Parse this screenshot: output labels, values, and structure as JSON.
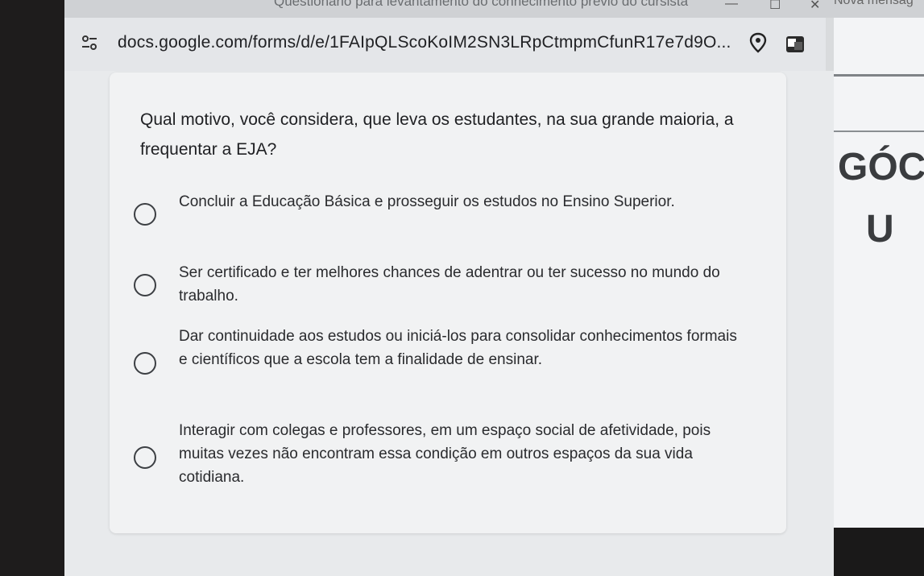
{
  "browser": {
    "window_title": "Questionário para levantamento do conhecimento prévio do cursista",
    "window_controls": {
      "minimize": "—",
      "maximize": "☐",
      "close": "✕"
    },
    "side_tab_text": "Nova mensag",
    "url": "docs.google.com/forms/d/e/1FAIpQLScoKoIM2SN3LRpCtmpmCfunR17e7d9O...",
    "icons": [
      "site-settings-icon",
      "location-icon",
      "translate-icon"
    ]
  },
  "form": {
    "question": "Qual motivo, você considera, que leva os estudantes, na sua grande maioria, a frequentar a EJA?",
    "options": [
      {
        "label": "Concluir a Educação Básica e prosseguir os estudos no Ensino Superior."
      },
      {
        "label": "Ser certificado e ter melhores chances de adentrar ou ter sucesso no mundo do trabalho."
      },
      {
        "label": "Dar continuidade aos estudos ou iniciá-los para consolidar conhecimentos formais e científicos que a escola tem a finalidade de ensinar."
      },
      {
        "label": "Interagir com colegas e professores, em um espaço social de afetividade, pois muitas vezes não encontram essa condição em outros espaços da sua vida cotidiana."
      }
    ]
  },
  "side_panel": {
    "heading": "GÓC",
    "letter": "U"
  },
  "colors": {
    "card_bg": "#f1f2f3",
    "text": "#202124",
    "radio_border": "#3c3f43"
  }
}
